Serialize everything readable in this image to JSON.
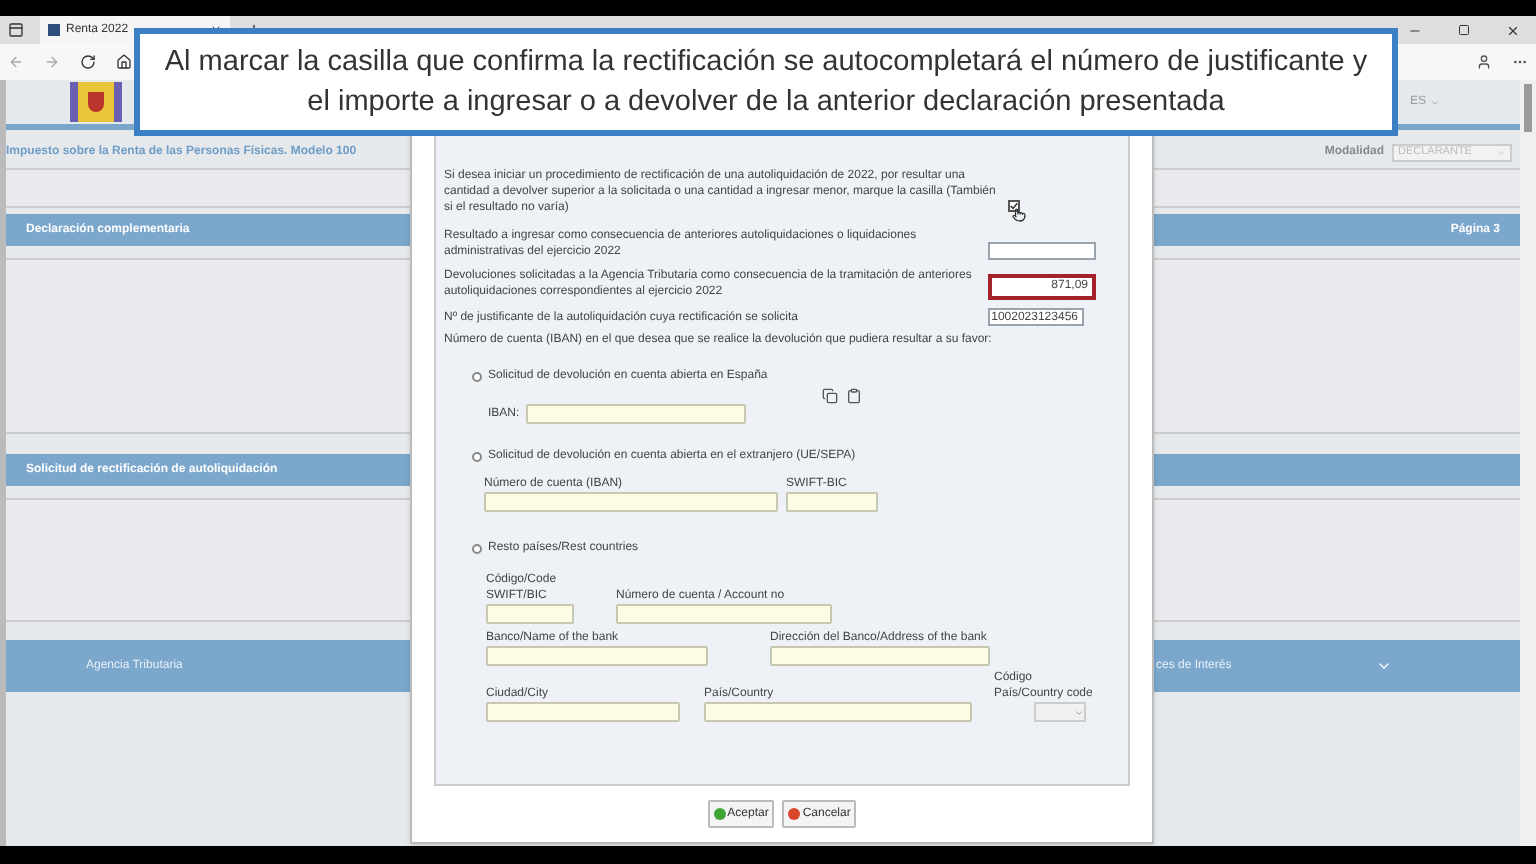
{
  "browser": {
    "tab_title": "Renta 2022"
  },
  "caption": [
    "Al marcar la casilla que confirma la rectificación se autocompletará el número de justificante y",
    "el importe a ingresar o a devolver de la anterior declaración presentada"
  ],
  "page": {
    "language": "ES",
    "title": "Impuesto sobre la Renta de las Personas Físicas. Modelo 100",
    "modalidad_label": "Modalidad",
    "modalidad_value": "DECLARANTE",
    "sections": [
      {
        "title": "Declaración complementaria",
        "page": "Página 3"
      },
      {
        "title": "Solicitud de rectificación de autoliquidación"
      }
    ],
    "footer": {
      "left": "Agencia Tributaria",
      "right": "ces de Interés"
    }
  },
  "dialog": {
    "intro": "Si desea iniciar un procedimiento de rectificación de una autoliquidación de 2022, por resultar una cantidad a devolver superior a la solicitada o una cantidad a ingresar menor, marque la casilla (También si el resultado no varía)",
    "confirm_checked": true,
    "rows": [
      {
        "label": "Resultado a ingresar como consecuencia de anteriores autoliquidaciones o liquidaciones administrativas del ejercicio 2022",
        "highlighted": false
      },
      {
        "label": "Devoluciones solicitadas a la Agencia Tributaria como consecuencia de la tramitación de anteriores autoliquidaciones correspondientes al ejercicio 2022",
        "value": "871,09",
        "highlighted": true
      },
      {
        "label": "Nº de justificante de la autoliquidación cuya rectificación se solicita",
        "value": "1002023123456",
        "highlighted": false
      }
    ],
    "account_prompt": "Número de cuenta (IBAN) en el que desea que se realice la devolución que pudiera resultar a su favor:",
    "options": [
      {
        "kind": "spain",
        "label": "Solicitud de devolución en cuenta abierta en España",
        "selected": false,
        "iban_label": "IBAN:"
      },
      {
        "kind": "sepa",
        "label": "Solicitud de devolución en cuenta abierta en el extranjero (UE/SEPA)",
        "selected": false,
        "account_label": "Número de cuenta (IBAN)",
        "swift_label": "SWIFT-BIC"
      },
      {
        "kind": "rest",
        "label": "Resto países/Rest countries",
        "selected": false,
        "code_label": "Código/Code",
        "swift_label": "SWIFT/BIC",
        "account_label": "Número de cuenta / Account no",
        "bank_label": "Banco/Name of the bank",
        "address_label": "Dirección del Banco/Address of the bank",
        "city_label": "Ciudad/City",
        "country_label": "País/Country",
        "country_code_label_1": "Código",
        "country_code_label_2": "País/Country code"
      }
    ],
    "buttons": [
      {
        "kind": "accept",
        "label": "Aceptar"
      },
      {
        "kind": "cancel",
        "label": "Cancelar"
      }
    ]
  }
}
